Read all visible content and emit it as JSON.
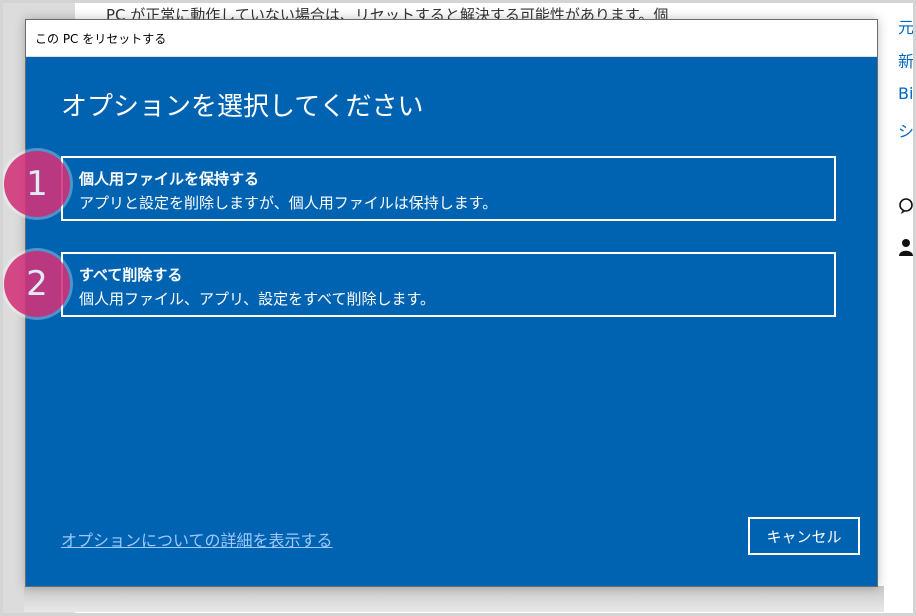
{
  "background": {
    "page_text": "PC が正常に動作していない場合は、リセットすると解決する可能性があります。個",
    "right_links": [
      "元",
      "新",
      "Bi",
      "シ"
    ],
    "right_icons": [
      "help-icon",
      "feedback-icon"
    ]
  },
  "dialog": {
    "title": "この PC をリセットする",
    "heading": "オプションを選択してください",
    "options": [
      {
        "title": "個人用ファイルを保持する",
        "description": "アプリと設定を削除しますが、個人用ファイルは保持します。"
      },
      {
        "title": "すべて削除する",
        "description": "個人用ファイル、アプリ、設定をすべて削除します。"
      }
    ],
    "details_link": "オプションについての詳細を表示する",
    "cancel_label": "キャンセル"
  },
  "markers": [
    "1",
    "2"
  ],
  "colors": {
    "dialog_bg": "#0063b1",
    "marker": "#d4337a",
    "link": "#9ec8ff"
  }
}
